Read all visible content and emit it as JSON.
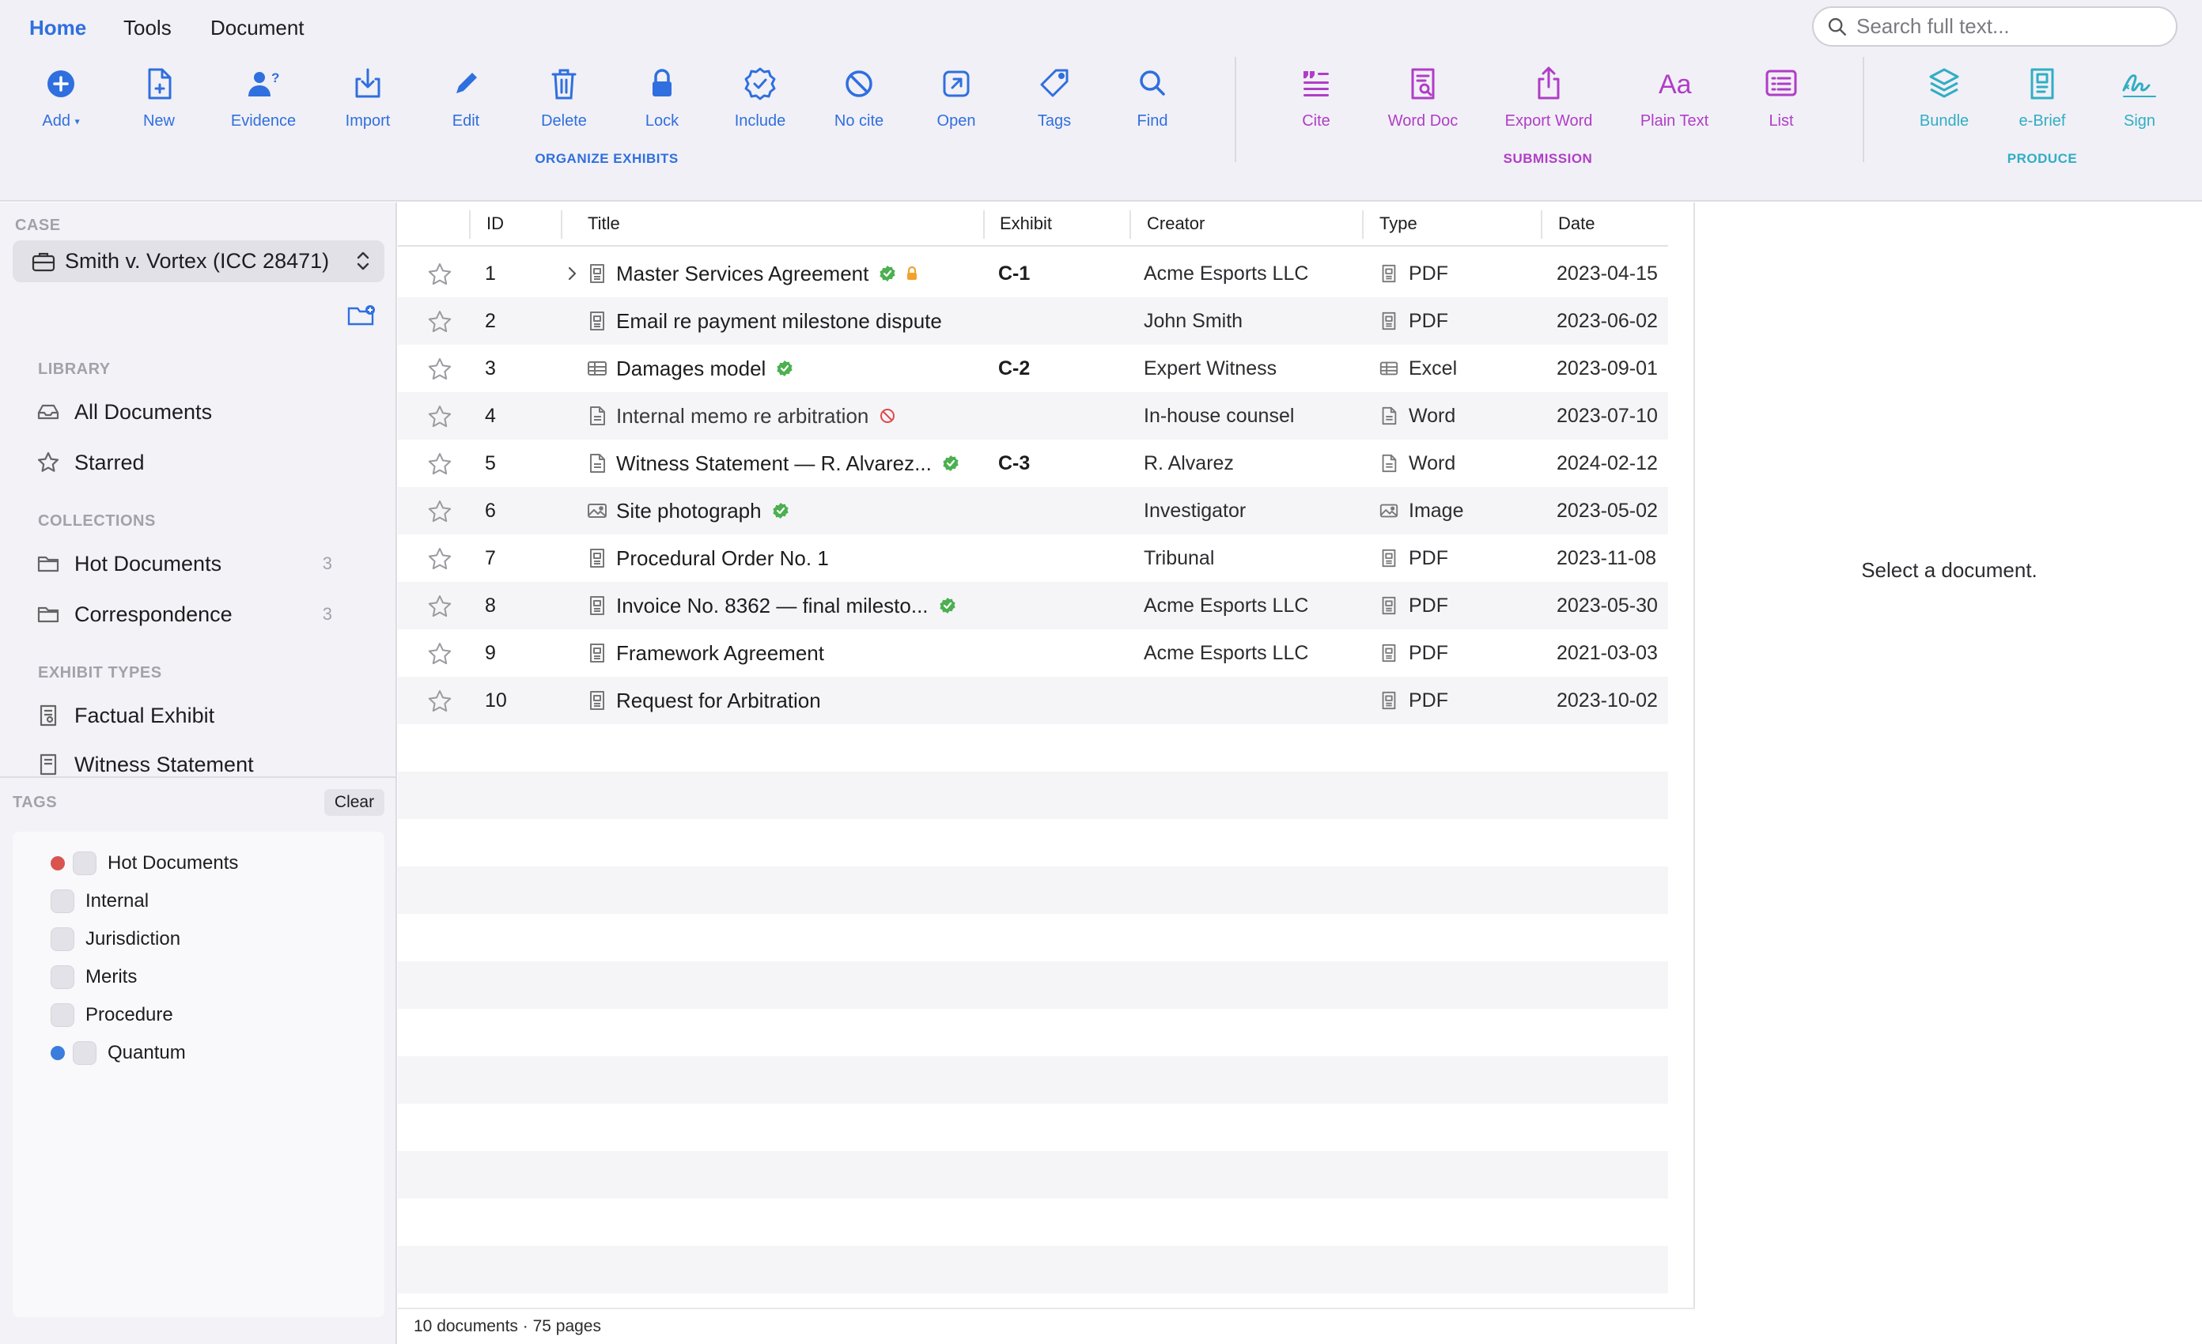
{
  "menu": {
    "tabs": [
      "Home",
      "Tools",
      "Document"
    ],
    "active": "Home"
  },
  "search": {
    "placeholder": "Search full text..."
  },
  "toolbar": {
    "organize": {
      "group_label": "ORGANIZE EXHIBITS",
      "tools": [
        {
          "label": "Add",
          "icon": "add-circle-icon"
        },
        {
          "label": "New",
          "icon": "new-document-icon"
        },
        {
          "label": "Evidence",
          "icon": "evidence-person-icon"
        },
        {
          "label": "Import",
          "icon": "import-tray-icon"
        },
        {
          "label": "Edit",
          "icon": "pencil-icon"
        },
        {
          "label": "Delete",
          "icon": "trash-icon"
        },
        {
          "label": "Lock",
          "icon": "lock-icon"
        },
        {
          "label": "Include",
          "icon": "include-check-badge-icon"
        },
        {
          "label": "No cite",
          "icon": "no-cite-prohibited-icon"
        },
        {
          "label": "Open",
          "icon": "open-external-icon"
        },
        {
          "label": "Tags",
          "icon": "tag-icon"
        },
        {
          "label": "Find",
          "icon": "magnifier-icon"
        }
      ]
    },
    "submission": {
      "group_label": "SUBMISSION",
      "tools": [
        {
          "label": "Cite",
          "icon": "cite-quote-icon"
        },
        {
          "label": "Word Doc",
          "icon": "word-doc-search-icon"
        },
        {
          "label": "Export Word",
          "icon": "export-share-icon"
        },
        {
          "label": "Plain Text",
          "icon": "plain-text-aa-icon"
        },
        {
          "label": "List",
          "icon": "list-icon"
        }
      ]
    },
    "produce": {
      "group_label": "PRODUCE",
      "tools": [
        {
          "label": "Bundle",
          "icon": "bundle-layers-icon"
        },
        {
          "label": "e-Brief",
          "icon": "ebrief-document-icon"
        },
        {
          "label": "Sign",
          "icon": "signature-icon"
        }
      ]
    },
    "colors": {
      "blue": "#2f6fdf",
      "purple": "#b03dc7",
      "teal": "#30aec4"
    }
  },
  "sidebar": {
    "case_header": "CASE",
    "case_name": "Smith v. Vortex (ICC 28471)",
    "library_header": "LIBRARY",
    "library": [
      {
        "label": "All Documents",
        "icon": "all-documents-tray-icon"
      },
      {
        "label": "Starred",
        "icon": "star-icon"
      }
    ],
    "collections_header": "COLLECTIONS",
    "collections": [
      {
        "label": "Hot Documents",
        "count": "3"
      },
      {
        "label": "Correspondence",
        "count": "3"
      }
    ],
    "exhibit_types_header": "EXHIBIT TYPES",
    "exhibit_types": [
      {
        "label": "Factual Exhibit"
      },
      {
        "label": "Witness Statement"
      }
    ]
  },
  "tags": {
    "header": "TAGS",
    "clear_label": "Clear",
    "items": [
      {
        "label": "Hot Documents",
        "dot": "#d9534f"
      },
      {
        "label": "Internal",
        "dot": ""
      },
      {
        "label": "Jurisdiction",
        "dot": ""
      },
      {
        "label": "Merits",
        "dot": ""
      },
      {
        "label": "Procedure",
        "dot": ""
      },
      {
        "label": "Quantum",
        "dot": "#3b7ddd"
      }
    ]
  },
  "table": {
    "columns": [
      "ID",
      "Title",
      "Exhibit",
      "Creator",
      "Type",
      "Date"
    ],
    "rows": [
      {
        "id": "1",
        "title": "Master Services Agreement",
        "exhibit": "C-1",
        "creator": "Acme Esports LLC",
        "type": "PDF",
        "date": "2023-04-15",
        "verified": true,
        "locked": true,
        "nocite": false,
        "expandable": true,
        "kind": "pdf",
        "muted": false
      },
      {
        "id": "2",
        "title": "Email re payment milestone dispute",
        "exhibit": "",
        "creator": "John Smith",
        "type": "PDF",
        "date": "2023-06-02",
        "verified": false,
        "locked": false,
        "nocite": false,
        "expandable": false,
        "kind": "pdf",
        "muted": false
      },
      {
        "id": "3",
        "title": "Damages model",
        "exhibit": "C-2",
        "creator": "Expert Witness",
        "type": "Excel",
        "date": "2023-09-01",
        "verified": true,
        "locked": false,
        "nocite": false,
        "expandable": false,
        "kind": "excel",
        "muted": false
      },
      {
        "id": "4",
        "title": "Internal memo re arbitration",
        "exhibit": "",
        "creator": "In-house counsel",
        "type": "Word",
        "date": "2023-07-10",
        "verified": false,
        "locked": false,
        "nocite": true,
        "expandable": false,
        "kind": "word",
        "muted": true
      },
      {
        "id": "5",
        "title": "Witness Statement — R. Alvarez...",
        "exhibit": "C-3",
        "creator": "R. Alvarez",
        "type": "Word",
        "date": "2024-02-12",
        "verified": true,
        "locked": false,
        "nocite": false,
        "expandable": false,
        "kind": "word",
        "muted": false
      },
      {
        "id": "6",
        "title": "Site photograph",
        "exhibit": "",
        "creator": "Investigator",
        "type": "Image",
        "date": "2023-05-02",
        "verified": true,
        "locked": false,
        "nocite": false,
        "expandable": false,
        "kind": "image",
        "muted": false
      },
      {
        "id": "7",
        "title": "Procedural Order No. 1",
        "exhibit": "",
        "creator": "Tribunal",
        "type": "PDF",
        "date": "2023-11-08",
        "verified": false,
        "locked": false,
        "nocite": false,
        "expandable": false,
        "kind": "pdf",
        "muted": false
      },
      {
        "id": "8",
        "title": "Invoice No. 8362 — final milesto...",
        "exhibit": "",
        "creator": "Acme Esports LLC",
        "type": "PDF",
        "date": "2023-05-30",
        "verified": true,
        "locked": false,
        "nocite": false,
        "expandable": false,
        "kind": "pdf",
        "muted": false
      },
      {
        "id": "9",
        "title": "Framework Agreement",
        "exhibit": "",
        "creator": "Acme Esports LLC",
        "type": "PDF",
        "date": "2021-03-03",
        "verified": false,
        "locked": false,
        "nocite": false,
        "expandable": false,
        "kind": "pdf",
        "muted": false
      },
      {
        "id": "10",
        "title": "Request for Arbitration",
        "exhibit": "",
        "creator": "",
        "type": "PDF",
        "date": "2023-10-02",
        "verified": false,
        "locked": false,
        "nocite": false,
        "expandable": false,
        "kind": "pdf",
        "muted": false
      }
    ]
  },
  "status": {
    "text": "10 documents · 75 pages"
  },
  "preview": {
    "empty_text": "Select a document."
  }
}
